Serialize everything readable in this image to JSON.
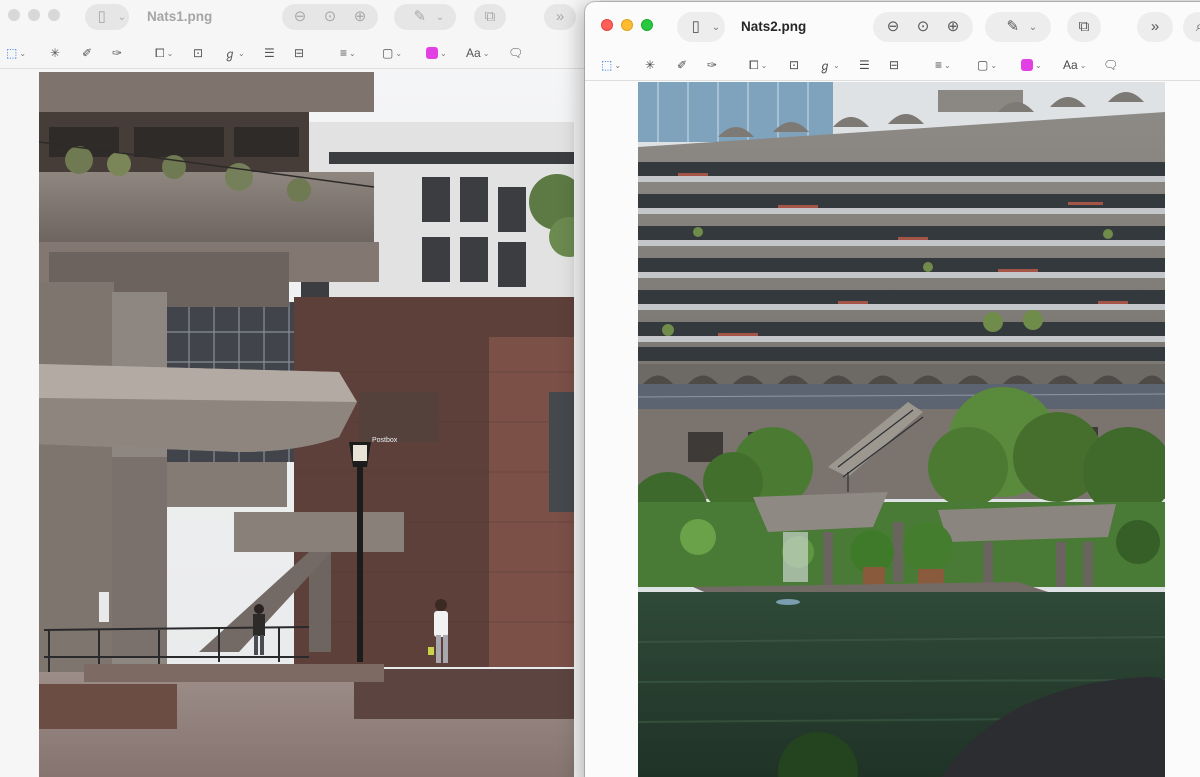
{
  "windows": [
    {
      "title": "Nats1.png",
      "focused": false
    },
    {
      "title": "Nats2.png",
      "focused": true
    }
  ],
  "toolbar": {
    "text_style_label": "Aa"
  },
  "photo1": {
    "sign_text": "Postbox"
  },
  "colors": {
    "accent": "#2b6fe0",
    "highlight_swatch": "#e240e4"
  }
}
